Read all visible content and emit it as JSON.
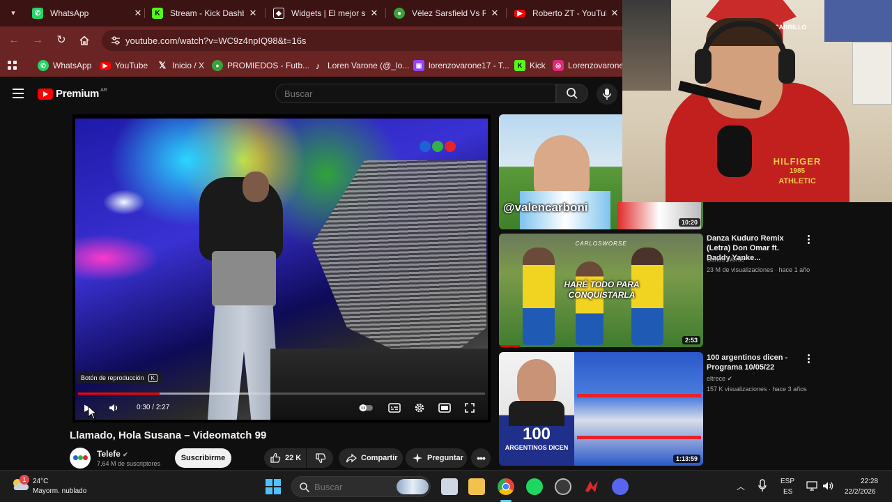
{
  "browser": {
    "tabs": [
      {
        "title": "WhatsApp",
        "icon": "whatsapp-icon",
        "color": "#25d366"
      },
      {
        "title": "Stream - Kick Dashbo",
        "icon": "kick-icon",
        "color": "#53fc18"
      },
      {
        "title": "Widgets | El mejor so",
        "icon": "widgets-icon",
        "color": "#ffffff"
      },
      {
        "title": "Vélez Sarsfield Vs Riv",
        "icon": "promiedos-icon",
        "color": "#3aa13a"
      },
      {
        "title": "Roberto ZT - YouTub",
        "icon": "youtube-icon",
        "color": "#ff0000"
      }
    ],
    "url": "youtube.com/watch?v=WC9z4npIQ98&t=16s",
    "bookmarks": [
      {
        "label": "WhatsApp",
        "icon": "whatsapp-icon",
        "color": "#25d366"
      },
      {
        "label": "YouTube",
        "icon": "youtube-icon",
        "color": "#ff0000"
      },
      {
        "label": "Inicio / X",
        "icon": "x-icon",
        "color": "#000000"
      },
      {
        "label": "PROMIEDOS - Futb...",
        "icon": "promiedos-icon",
        "color": "#3aa13a"
      },
      {
        "label": "Loren Varone (@_lo...",
        "icon": "tiktok-icon",
        "color": "#000000"
      },
      {
        "label": "lorenzovarone17 - T...",
        "icon": "twitch-icon",
        "color": "#9146ff"
      },
      {
        "label": "Kick",
        "icon": "kick-icon",
        "color": "#53fc18"
      },
      {
        "label": "Lorenzovarone (",
        "icon": "instagram-icon",
        "color": "#dd2a7b"
      }
    ]
  },
  "youtube": {
    "logo_text": "Premium",
    "country_code": "AR",
    "search_placeholder": "Buscar",
    "player": {
      "tooltip": "Botón de reproducción",
      "tooltip_key": "K",
      "current_time": "0:30",
      "duration": "2:27",
      "played_fraction": 0.2,
      "loaded_fraction": 0.42
    },
    "video_title": "Llamado, Hola Susana – Videomatch 99",
    "channel": {
      "name": "Telefe",
      "subscribers": "7,64 M de suscriptores",
      "subscribe_label": "Suscribirme"
    },
    "actions": {
      "likes": "22 K",
      "share": "Compartir",
      "ask": "Preguntar"
    },
    "recommendations": [
      {
        "thumb_text": "@valencarboni",
        "duration": "10:20",
        "title": "",
        "channel": "",
        "meta": ""
      },
      {
        "thumb_text": "HARÉ TODO PARA CONQUISTARLA",
        "thumb_tag": "CARLOSWORSE",
        "duration": "2:53",
        "title": "Danza Kuduro Remix (Letra) Don Omar ft. Daddy Yanke...",
        "channel": "Carlos Worse",
        "meta": "23 M de visualizaciones · hace 1 año"
      },
      {
        "thumb_text": "100",
        "thumb_sub": "ARGENTINOS DICEN",
        "duration": "1:13:59",
        "title": "100 argentinos dicen - Programa 10/05/22",
        "channel": "eltrece",
        "meta": "157 K visualizaciones · hace 3 años"
      }
    ]
  },
  "taskbar": {
    "weather_temp": "24°C",
    "weather_desc": "Mayorm. nublado",
    "weather_badge": "1",
    "search_placeholder": "Buscar",
    "lang_top": "ESP",
    "lang_bottom": "ES",
    "time": "22:28",
    "date": "22/2/2026"
  },
  "webcam": {
    "shirt_text_top": "HILFIGER",
    "shirt_year": "1985",
    "shirt_text_bottom": "ATHLETIC",
    "jersey_name": "CARRILLO"
  },
  "colors": {
    "tab_strip": "#3c1313",
    "toolbar": "#6a2424",
    "youtube_bg": "#0f0f0f",
    "accent_red": "#ff0000"
  }
}
